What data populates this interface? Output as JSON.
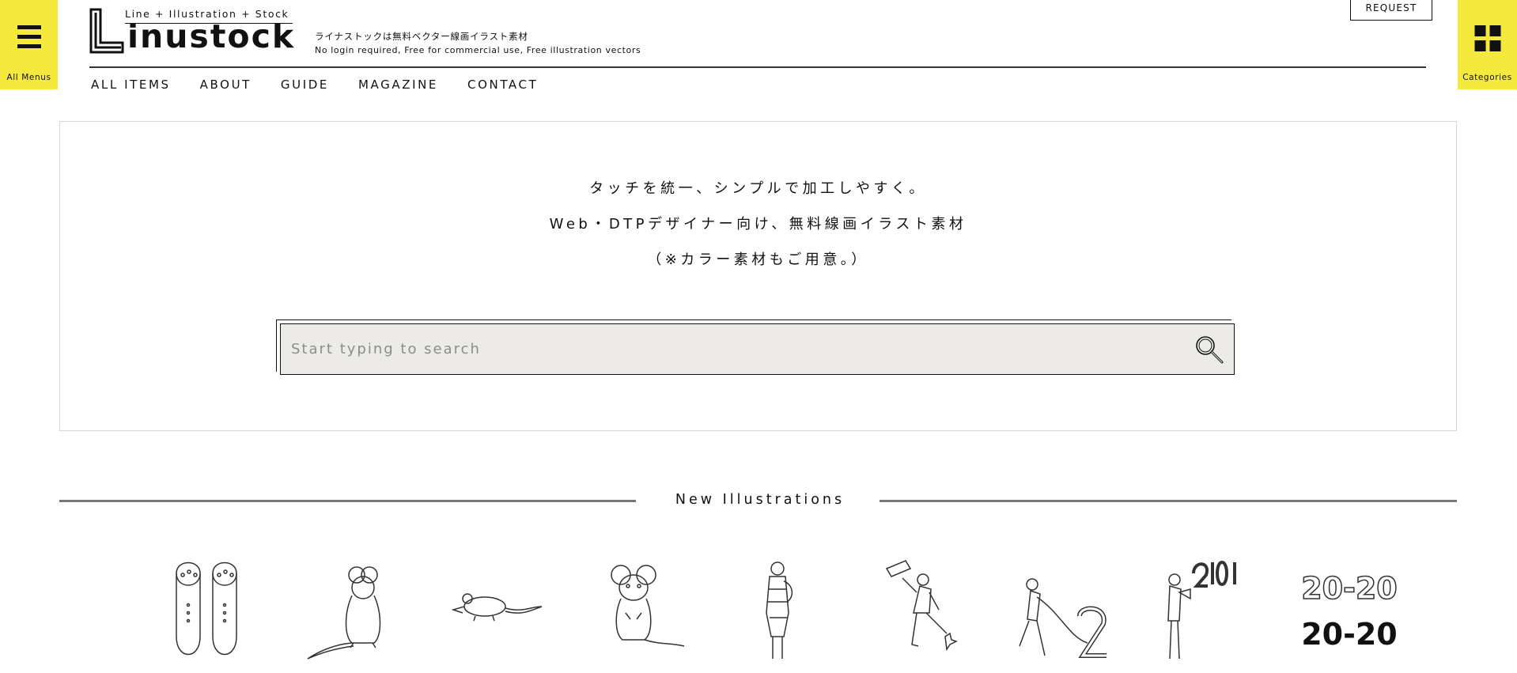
{
  "corner": {
    "left_label": "All Menus",
    "right_label": "Categories"
  },
  "logo": {
    "tag": "Line + Illustration + Stock",
    "word": "inustock"
  },
  "tagline": {
    "jp": "ライナストックは無料ベクター線画イラスト素材",
    "en": "No login required, Free for commercial use, Free illustration vectors"
  },
  "request_label": "REQUEST",
  "nav": {
    "items": [
      {
        "label": "ALL ITEMS"
      },
      {
        "label": "ABOUT"
      },
      {
        "label": "GUIDE"
      },
      {
        "label": "MAGAZINE"
      },
      {
        "label": "CONTACT"
      }
    ]
  },
  "hero": {
    "line1": "タッチを統一、シンプルで加工しやすく。",
    "line2": "Web・DTPデザイナー向け、無料線画イラスト素材",
    "line3": "（※カラー素材もご用意。）"
  },
  "search": {
    "placeholder": "Start typing to search",
    "icon": "magnifier-icon"
  },
  "section": {
    "title": "New Illustrations",
    "line_color": "#777777"
  },
  "thumbnails": [
    {
      "icon": "sandals-illustration"
    },
    {
      "icon": "rat-back-illustration"
    },
    {
      "icon": "mouse-side-illustration"
    },
    {
      "icon": "rat-front-illustration"
    },
    {
      "icon": "girl-winter-illustration"
    },
    {
      "icon": "kick-sign-illustration"
    },
    {
      "icon": "pulling-rope-2-illustration"
    },
    {
      "icon": "megaphone-2019-illustration"
    },
    {
      "icon": "2020-text-illustration"
    }
  ],
  "colors": {
    "accent_yellow": "#f4e93c",
    "search_bg": "#ecebe7",
    "text": "#111111"
  }
}
